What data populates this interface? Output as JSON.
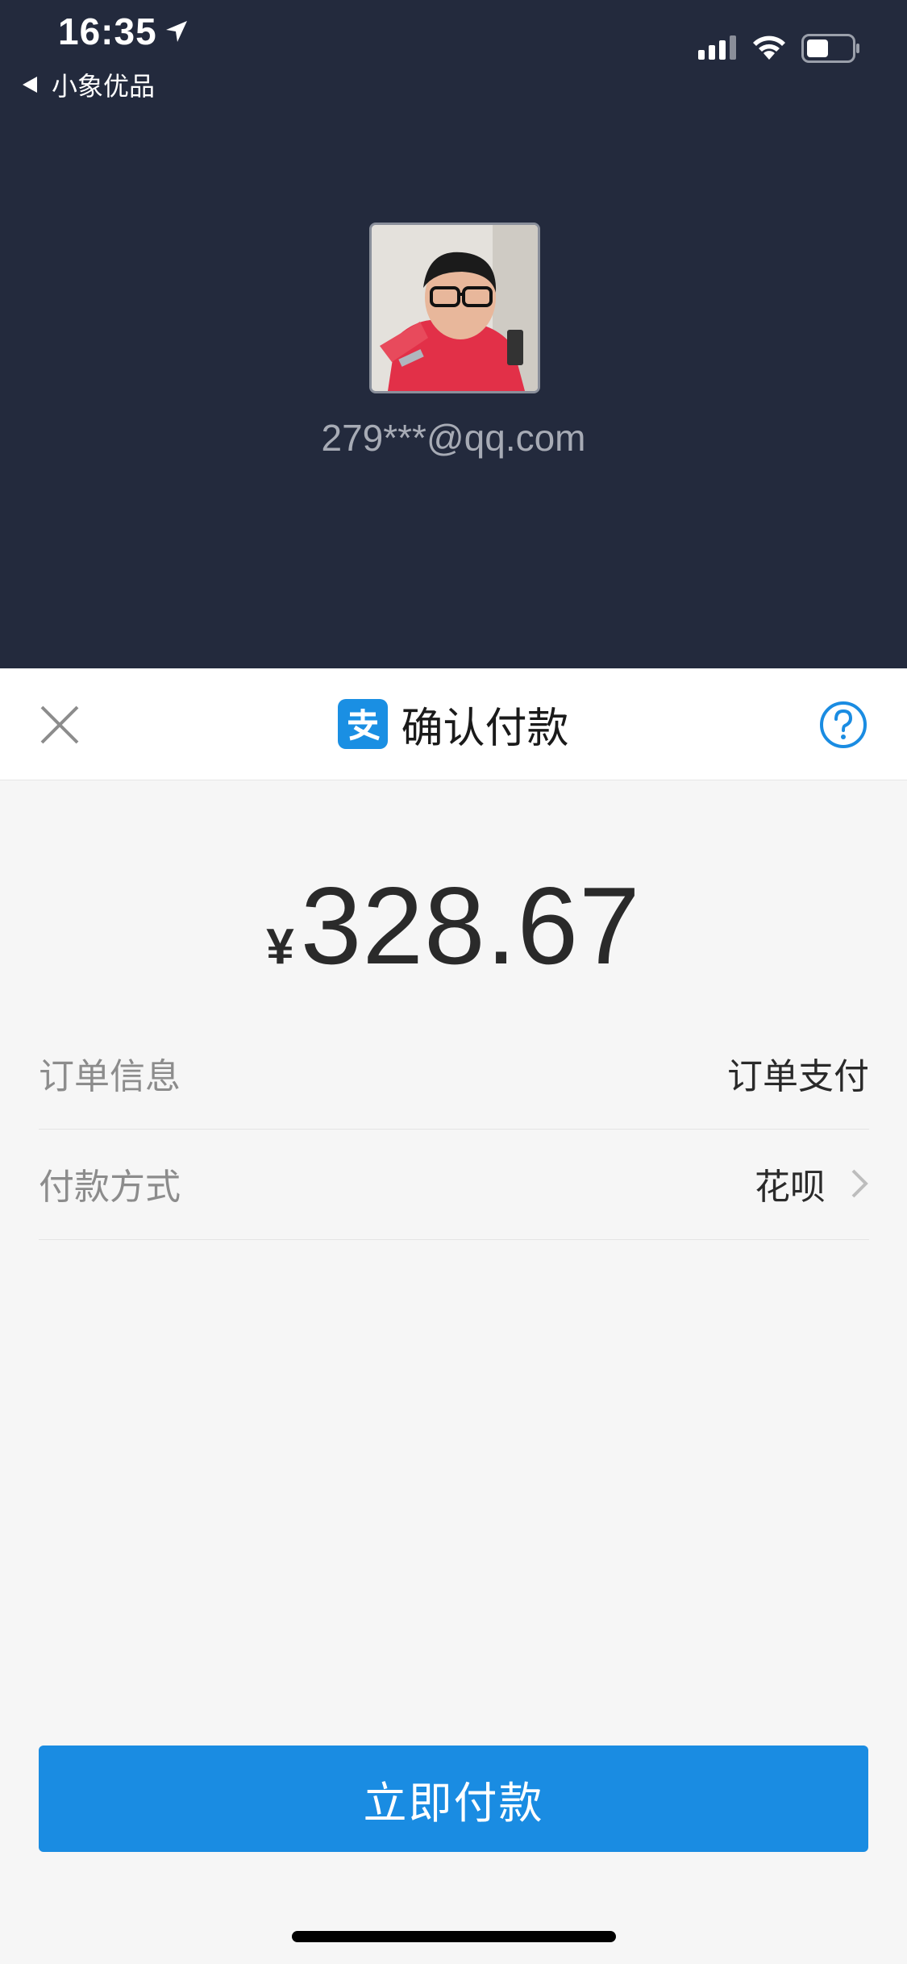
{
  "status_bar": {
    "time": "16:35",
    "back_app": "小象优品"
  },
  "account": {
    "email": "279***@qq.com"
  },
  "sheet": {
    "title": "确认付款",
    "amount_symbol": "¥",
    "amount": "328.67",
    "rows": [
      {
        "label": "订单信息",
        "value": "订单支付"
      },
      {
        "label": "付款方式",
        "value": "花呗"
      }
    ],
    "pay_button": "立即付款"
  },
  "colors": {
    "top_bg": "#232a3d",
    "accent": "#1a8ce2"
  },
  "icons": [
    "location-arrow-icon",
    "back-triangle-icon",
    "signal-icon",
    "wifi-icon",
    "battery-icon",
    "close-icon",
    "alipay-logo-icon",
    "help-icon",
    "chevron-right-icon"
  ]
}
